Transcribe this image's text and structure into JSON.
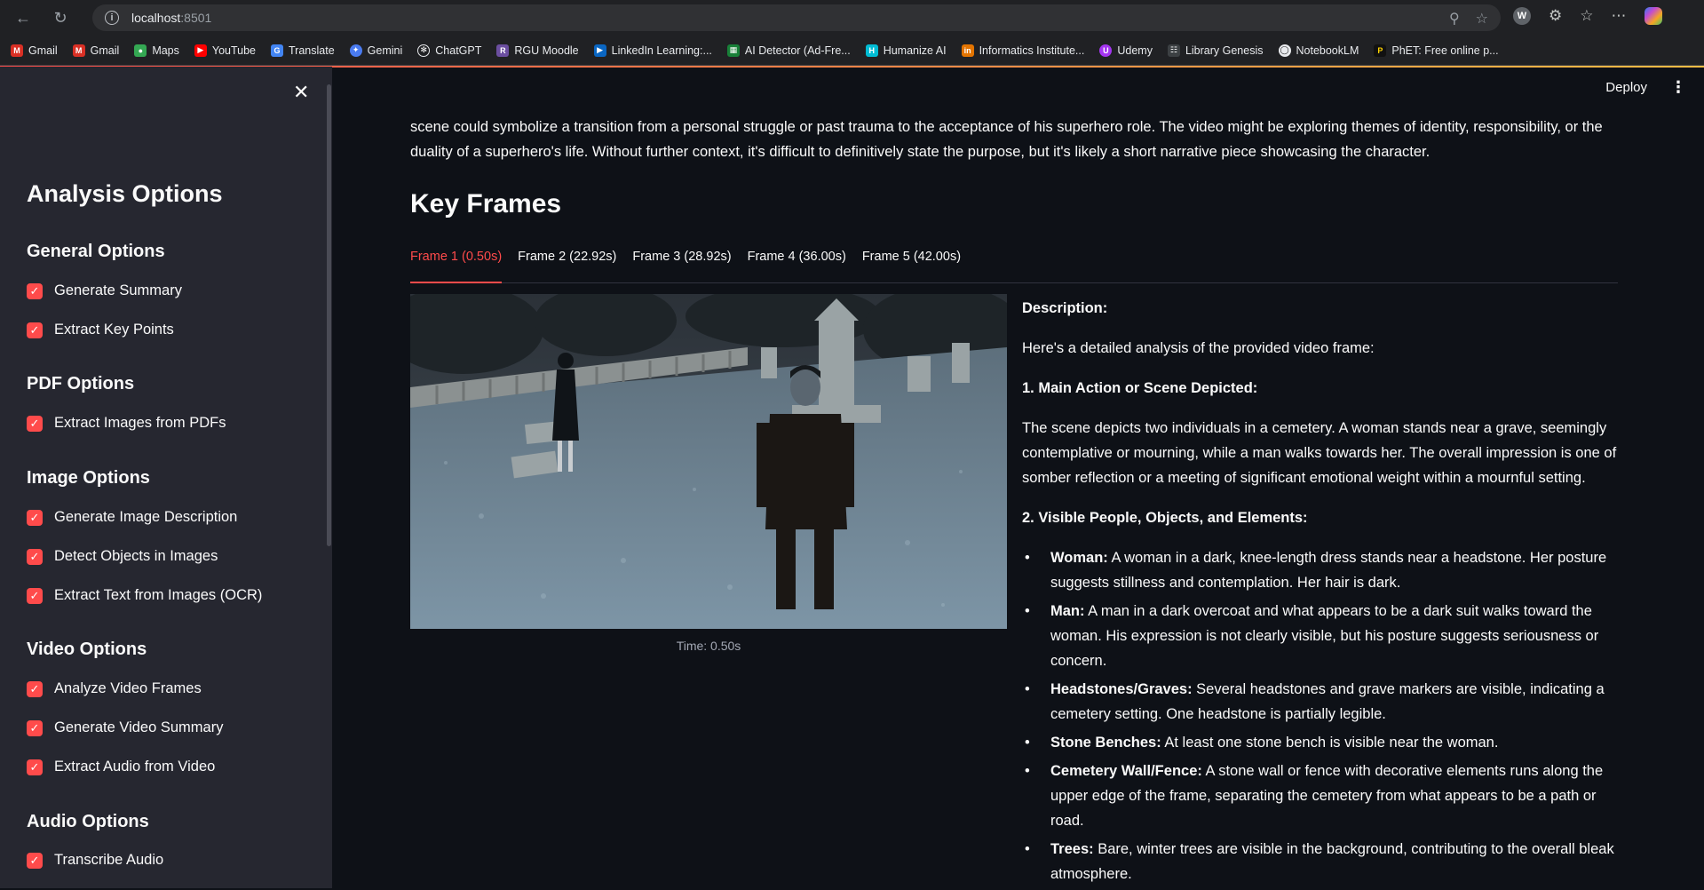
{
  "browser": {
    "url_host": "localhost",
    "url_port": ":8501",
    "bookmarks": [
      "Gmail",
      "Gmail",
      "Maps",
      "YouTube",
      "Translate",
      "Gemini",
      "ChatGPT",
      "RGU Moodle",
      "LinkedIn Learning:...",
      "AI Detector (Ad-Fre...",
      "Humanize AI",
      "Informatics Institute...",
      "Udemy",
      "Library Genesis",
      "NotebookLM",
      "PhET: Free online p..."
    ]
  },
  "header": {
    "deploy_label": "Deploy"
  },
  "sidebar": {
    "title": "Analysis Options",
    "sections": [
      {
        "title": "General Options",
        "items": [
          "Generate Summary",
          "Extract Key Points"
        ]
      },
      {
        "title": "PDF Options",
        "items": [
          "Extract Images from PDFs"
        ]
      },
      {
        "title": "Image Options",
        "items": [
          "Generate Image Description",
          "Detect Objects in Images",
          "Extract Text from Images (OCR)"
        ]
      },
      {
        "title": "Video Options",
        "items": [
          "Analyze Video Frames",
          "Generate Video Summary",
          "Extract Audio from Video"
        ]
      },
      {
        "title": "Audio Options",
        "items": [
          "Transcribe Audio"
        ]
      }
    ]
  },
  "main": {
    "intro_line1": "scene could symbolize a transition from a personal struggle or past trauma to the acceptance of his superhero role. The video might be exploring themes of identity, responsibility, or the",
    "intro_line2": "duality of a superhero's life. Without further context, it's difficult to definitively state the purpose, but it's likely a short narrative piece showcasing the character.",
    "key_frames_title": "Key Frames",
    "tabs": [
      "Frame 1 (0.50s)",
      "Frame 2 (22.92s)",
      "Frame 3 (28.92s)",
      "Frame 4 (36.00s)",
      "Frame 5 (42.00s)"
    ],
    "caption": "Time: 0.50s",
    "description": {
      "heading": "Description:",
      "intro": "Here's a detailed analysis of the provided video frame:",
      "h1": "1. Main Action or Scene Depicted:",
      "p1": "The scene depicts two individuals in a cemetery. A woman stands near a grave, seemingly contemplative or mourning, while a man walks towards her. The overall impression is one of somber reflection or a meeting of significant emotional weight within a mournful setting.",
      "h2": "2. Visible People, Objects, and Elements:",
      "bullets": [
        {
          "label": "Woman:",
          "text": " A woman in a dark, knee-length dress stands near a headstone. Her posture suggests stillness and contemplation. Her hair is dark."
        },
        {
          "label": "Man:",
          "text": " A man in a dark overcoat and what appears to be a dark suit walks toward the woman. His expression is not clearly visible, but his posture suggests seriousness or concern."
        },
        {
          "label": "Headstones/Graves:",
          "text": " Several headstones and grave markers are visible, indicating a cemetery setting. One headstone is partially legible."
        },
        {
          "label": "Stone Benches:",
          "text": " At least one stone bench is visible near the woman."
        },
        {
          "label": "Cemetery Wall/Fence:",
          "text": " A stone wall or fence with decorative elements runs along the upper edge of the frame, separating the cemetery from what appears to be a path or road."
        },
        {
          "label": "Trees:",
          "text": " Bare, winter trees are visible in the background, contributing to the overall bleak atmosphere."
        }
      ]
    }
  },
  "colors": {
    "accent": "#ff4b4b",
    "sidebar_bg": "#262730",
    "main_bg": "#0e1117"
  }
}
